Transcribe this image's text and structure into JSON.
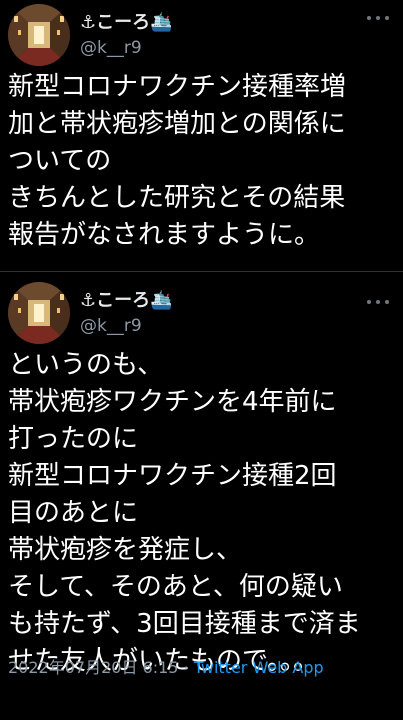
{
  "tweets": [
    {
      "display_name": "⚓こーろ🛳️",
      "handle": "@k__r9",
      "lines": [
        "新型コロナワクチン接種率増",
        "加と帯状疱疹増加との関係に",
        "ついての",
        "きちんとした研究とその結果",
        "報告がなされますように。"
      ]
    },
    {
      "display_name": "⚓こーろ🛳️",
      "handle": "@k__r9",
      "lines": [
        "というのも、",
        "帯状疱疹ワクチンを4年前に",
        "打ったのに",
        "新型コロナワクチン接種2回",
        "目のあとに",
        "帯状疱疹を発症し、",
        "そして、そのあと、何の疑い",
        "も持たず、3回目接種まで済ま",
        "せた友人がいたもので。。。"
      ],
      "timestamp": "2022年07月20日 6:15",
      "separator": " · ",
      "source_app": "Twitter Web App"
    }
  ],
  "icons": [
    "avatar",
    "more-icon"
  ],
  "colors": {
    "background": "#000000",
    "text": "#ffffff",
    "secondary": "#8b98a5",
    "link": "#1d9bf0"
  }
}
